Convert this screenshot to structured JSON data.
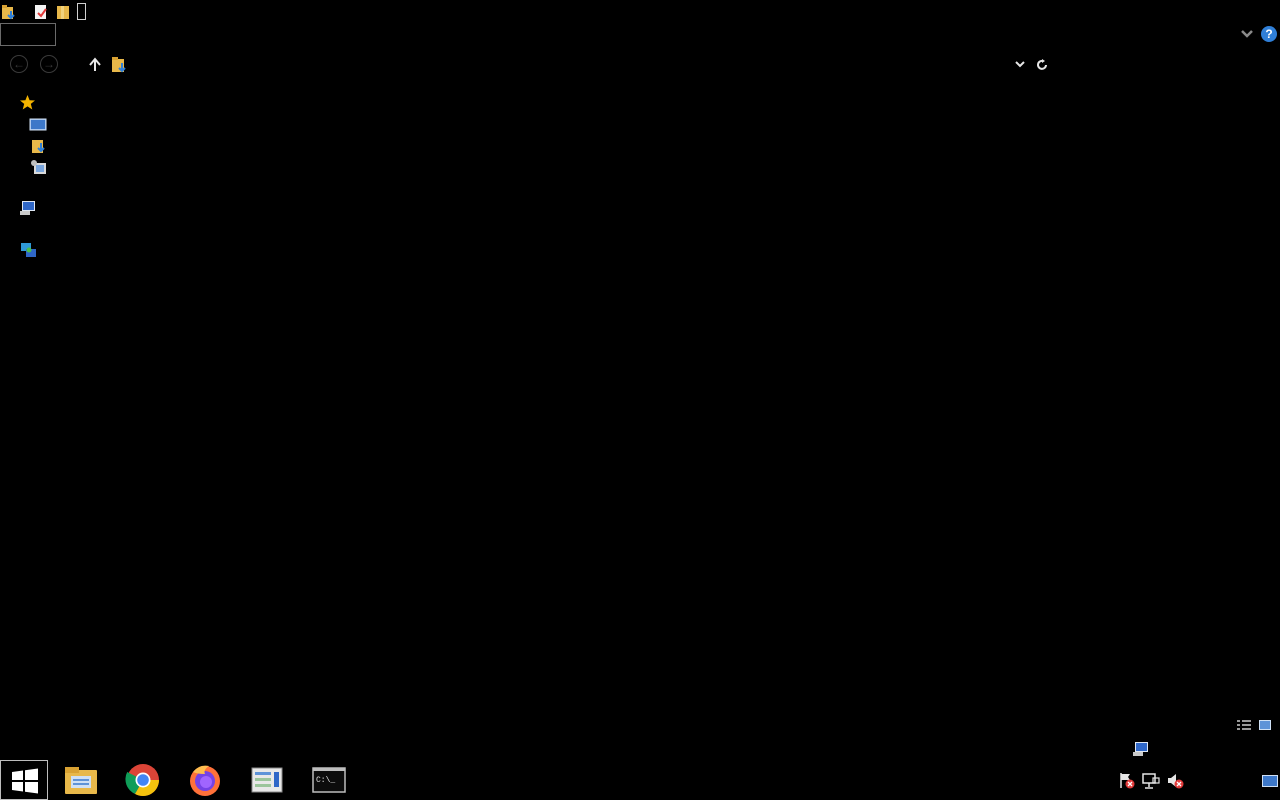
{
  "quick_access": {
    "icons": [
      "download-folder-icon",
      "properties-icon",
      "new-folder-icon"
    ]
  },
  "ribbon": {
    "help_glyph": "?",
    "expand_glyph": "⌄"
  },
  "address_bar": {
    "back_glyph": "←",
    "forward_glyph": "→",
    "up_glyph": "↑",
    "dropdown_glyph": "⌄",
    "refresh_glyph": "↻"
  },
  "nav_pane": {
    "items": [
      {
        "icon": "star-icon",
        "label": ""
      },
      {
        "icon": "desktop-icon",
        "label": ""
      },
      {
        "icon": "downloads-icon",
        "label": ""
      },
      {
        "icon": "recent-places-icon",
        "label": ""
      },
      {
        "icon": "this-pc-icon",
        "label": ""
      },
      {
        "icon": "network-icon",
        "label": ""
      }
    ]
  },
  "taskbar": {
    "apps": [
      "file-explorer",
      "google-chrome",
      "firefox",
      "server-manager",
      "command-prompt"
    ],
    "cmd_text": "C:\\_",
    "tray": [
      "action-center-alert",
      "network-icon",
      "volume-muted"
    ]
  },
  "colors": {
    "background": "#000000",
    "folder": "#e8b84a",
    "accent_blue": "#2f7fd8",
    "alert_red": "#e23b3b"
  }
}
